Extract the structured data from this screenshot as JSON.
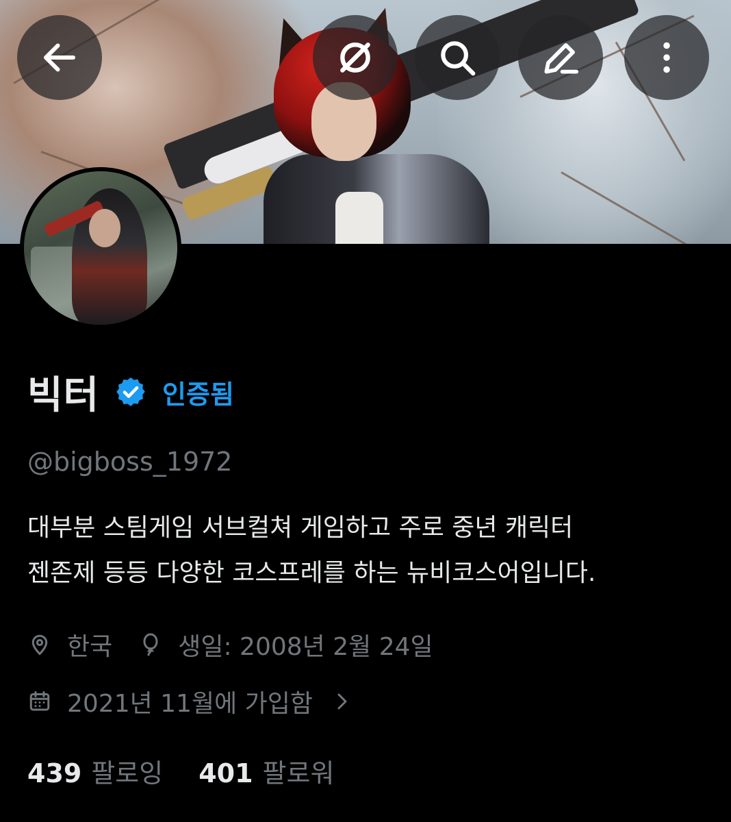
{
  "profile": {
    "display_name": "빅터",
    "verified_label": "인증됨",
    "handle": "@bigboss_1972",
    "bio_line1": "대부분 스팀게임 서브컬쳐 게임하고 주로 중년 캐릭터",
    "bio_line2": "젠존제 등등 다양한 코스프레를 하는 뉴비코스어입니다.",
    "location": "한국",
    "birthday": "생일: 2008년 2월 24일",
    "joined": "2021년 11월에 가입함",
    "following_count": "439",
    "following_label": "팔로잉",
    "followers_count": "401",
    "followers_label": "팔로워"
  },
  "topbar": {
    "icons": [
      "back-arrow-icon",
      "grok-icon",
      "search-icon",
      "edit-icon",
      "more-vertical-icon"
    ]
  },
  "colors": {
    "background": "#000000",
    "accent": "#1d9bf0",
    "primary_text": "#e7e9ea",
    "secondary_text": "#71767b"
  }
}
